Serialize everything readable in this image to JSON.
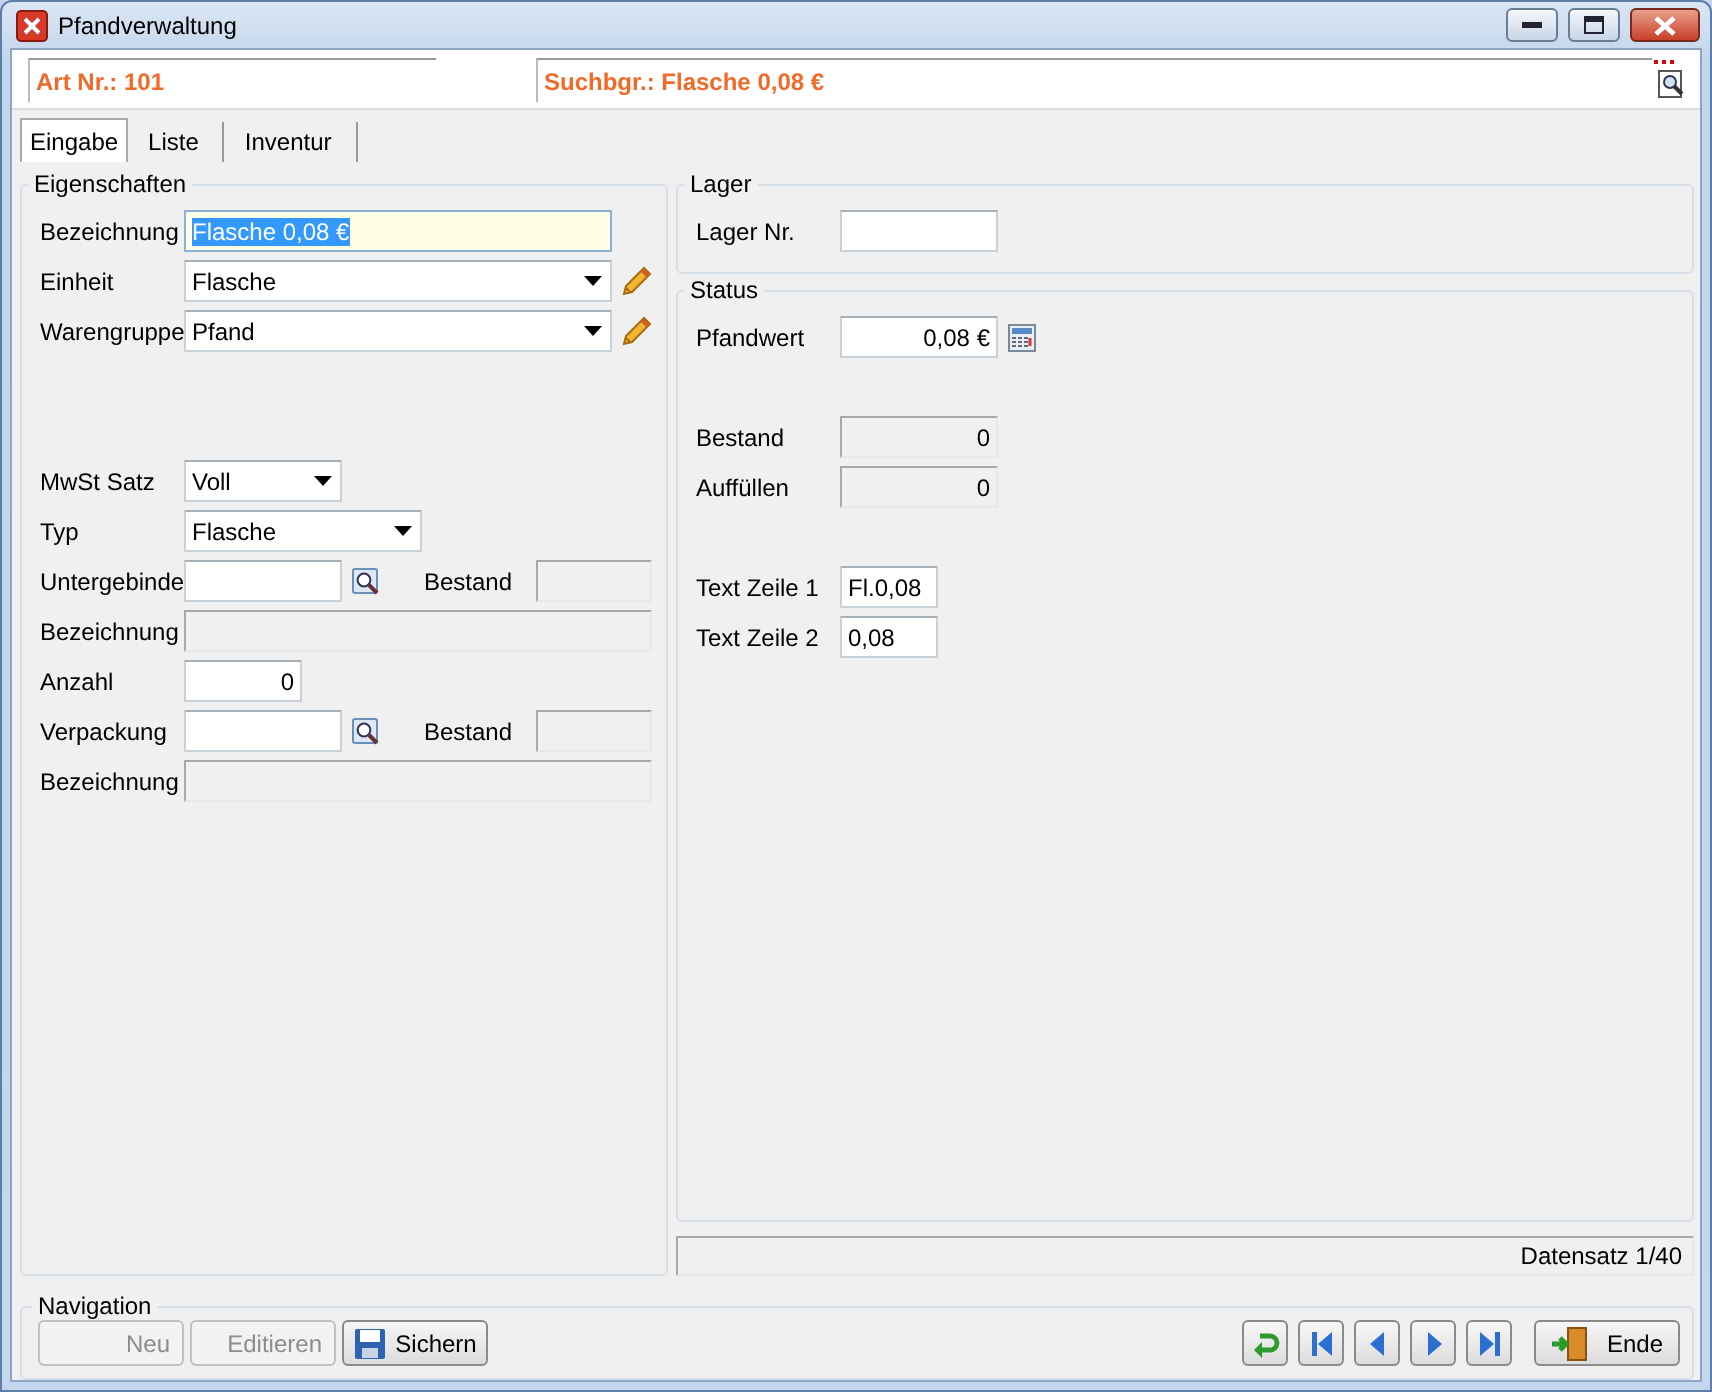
{
  "window": {
    "title": "Pfandverwaltung"
  },
  "header": {
    "article": "Art Nr.: 101",
    "search": "Suchbgr.: Flasche 0,08 €"
  },
  "tabs": [
    {
      "label": "Eingabe",
      "selected": true
    },
    {
      "label": "Liste",
      "selected": false
    },
    {
      "label": "Inventur",
      "selected": false
    }
  ],
  "eigenschaften": {
    "title": "Eigenschaften",
    "sections": [
      [
        {
          "kind": "text",
          "label": "Bezeichnung",
          "value": "Flasche 0,08 €",
          "highlighted": true
        },
        {
          "kind": "combo-edit",
          "label": "Einheit",
          "value": "Flasche"
        },
        {
          "kind": "combo-edit",
          "label": "Warengruppe",
          "value": "Pfand"
        }
      ],
      [
        {
          "kind": "combo",
          "label": "MwSt Satz",
          "value": "Voll"
        },
        {
          "kind": "combo",
          "label": "Typ",
          "value": "Flasche"
        },
        {
          "kind": "lookup",
          "label": "Untergebinde",
          "stock_label": "Bestand"
        },
        {
          "kind": "readonly",
          "label": "Bezeichnung"
        },
        {
          "kind": "number",
          "label": "Anzahl",
          "value": "0"
        },
        {
          "kind": "lookup",
          "label": "Verpackung",
          "stock_label": "Bestand"
        },
        {
          "kind": "readonly",
          "label": "Bezeichnung"
        }
      ]
    ]
  },
  "lager": {
    "title": "Lager",
    "sections": [
      [
        {
          "kind": "text",
          "label": "Lager Nr."
        }
      ]
    ]
  },
  "status": {
    "title": "Status",
    "sections": [
      [
        {
          "kind": "currency",
          "label": "Pfandwert",
          "value": "0,08 €"
        }
      ],
      [
        {
          "kind": "readonly",
          "label": "Bestand",
          "value": "0"
        },
        {
          "kind": "readonly",
          "label": "Auffüllen",
          "value": "0"
        }
      ],
      [
        {
          "kind": "short",
          "label": "Text Zeile 1",
          "value": "Fl.0,08"
        },
        {
          "kind": "short",
          "label": "Text Zeile 2",
          "value": "0,08"
        }
      ]
    ]
  },
  "status_bar": {
    "text": "Datensatz 1/40"
  },
  "navigation": {
    "title": "Navigation",
    "buttons": [
      {
        "label": "Neu",
        "disabled": true
      },
      {
        "label": "Editieren",
        "disabled": true
      },
      {
        "label": "Sichern",
        "disabled": false,
        "kind": "save"
      }
    ],
    "record_buttons": [
      {
        "kind": "refresh"
      },
      {
        "kind": "first"
      },
      {
        "kind": "previous"
      },
      {
        "kind": "next"
      },
      {
        "kind": "last"
      }
    ],
    "exit_button": {
      "label": "Ende"
    }
  }
}
